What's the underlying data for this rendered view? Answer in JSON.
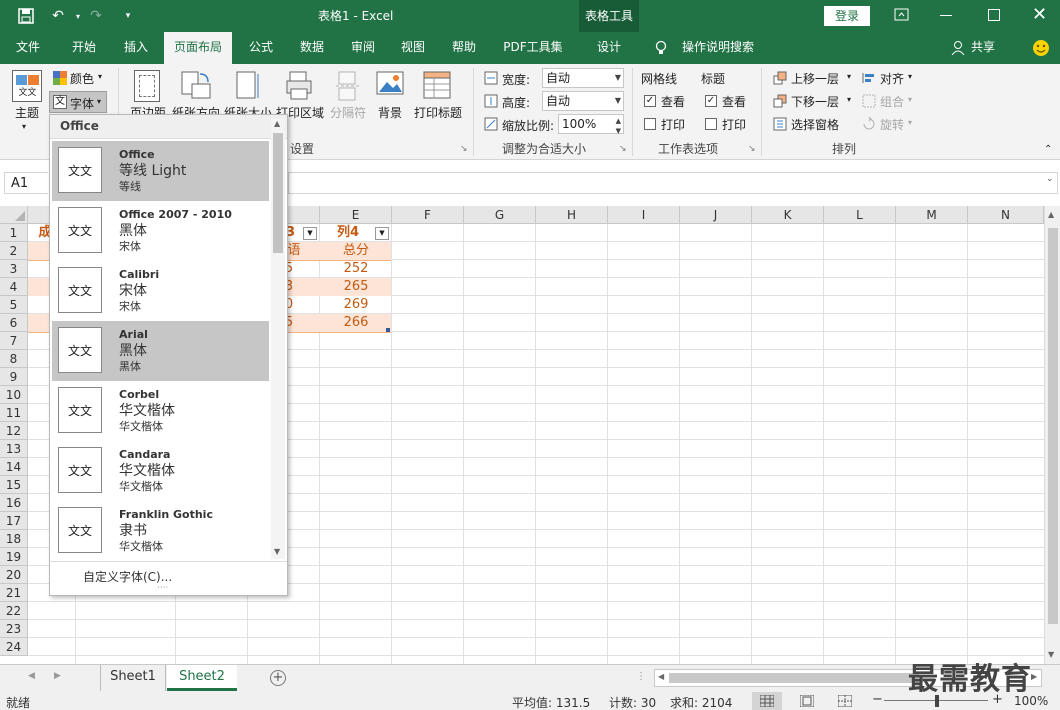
{
  "titlebar": {
    "doc_title": "表格1 - Excel",
    "context_tab_group": "表格工具",
    "login": "登录"
  },
  "tabs": [
    {
      "label": "文件"
    },
    {
      "label": "开始"
    },
    {
      "label": "插入"
    },
    {
      "label": "页面布局"
    },
    {
      "label": "公式"
    },
    {
      "label": "数据"
    },
    {
      "label": "审阅"
    },
    {
      "label": "视图"
    },
    {
      "label": "帮助"
    },
    {
      "label": "PDF工具集"
    },
    {
      "label": "设计"
    }
  ],
  "tell_me": "操作说明搜索",
  "share": "共享",
  "ribbon": {
    "theme": "主题",
    "colors": "颜色",
    "fonts": "字体",
    "margins": "页边距",
    "orientation": "纸张方向",
    "size": "纸张大小",
    "print_area": "打印区域",
    "breaks": "分隔符",
    "background": "背景",
    "print_titles": "打印标题",
    "page_setup_group": "设置",
    "width_label": "宽度:",
    "width_value": "自动",
    "height_label": "高度:",
    "height_value": "自动",
    "scale_label": "缩放比例:",
    "scale_value": "100%",
    "scale_group": "调整为合适大小",
    "gridlines": "网格线",
    "headings": "标题",
    "view": "查看",
    "print": "打印",
    "sheet_options_group": "工作表选项",
    "bring_forward": "上移一层",
    "send_backward": "下移一层",
    "selection_pane": "选择窗格",
    "align": "对齐",
    "group": "组合",
    "rotate": "旋转",
    "arrange_group": "排列"
  },
  "formula_bar": {
    "name_box": "A1"
  },
  "columns": [
    "E",
    "F",
    "G",
    "H",
    "I",
    "J",
    "K",
    "L",
    "M",
    "N"
  ],
  "rows": [
    "1",
    "2",
    "3",
    "4",
    "5",
    "6",
    "7",
    "8",
    "9",
    "10",
    "11",
    "12",
    "13",
    "14",
    "15",
    "16",
    "17",
    "18",
    "19",
    "20",
    "21",
    "22",
    "23",
    "24"
  ],
  "cells": {
    "a1": "成",
    "d1": "3",
    "e1": "列4",
    "d2": "语",
    "e2": "总分",
    "d3": "5",
    "e3": "252",
    "d4": "3",
    "e4": "265",
    "d5": "0",
    "e5": "269",
    "d6": "5",
    "e6": "266"
  },
  "font_dropdown": {
    "header": "Office",
    "items": [
      {
        "name": "Office",
        "heading": "等线 Light",
        "body": "等线",
        "thumb": "文文",
        "selected": true
      },
      {
        "name": "Office 2007 - 2010",
        "heading": "黑体",
        "body": "宋体",
        "thumb": "文文",
        "selected": false
      },
      {
        "name": "Calibri",
        "heading": "宋体",
        "body": "宋体",
        "thumb": "文文",
        "selected": false
      },
      {
        "name": "Arial",
        "heading": "黑体",
        "body": "黑体",
        "thumb": "文文",
        "selected": true
      },
      {
        "name": "Corbel",
        "heading": "华文楷体",
        "body": "华文楷体",
        "thumb": "文文",
        "selected": false
      },
      {
        "name": "Candara",
        "heading": "华文楷体",
        "body": "华文楷体",
        "thumb": "文文",
        "selected": false
      },
      {
        "name": "Franklin Gothic",
        "heading": "隶书",
        "body": "华文楷体",
        "thumb": "文文",
        "selected": false
      }
    ],
    "custom": "自定义字体(C)...",
    "resize_grip": "····"
  },
  "sheets": [
    {
      "label": "Sheet1"
    },
    {
      "label": "Sheet2"
    }
  ],
  "status": {
    "ready": "就绪",
    "average": "平均值: 131.5",
    "count": "计数: 30",
    "sum": "求和: 2104",
    "zoom": "100%"
  },
  "watermark": "最需教育",
  "colors": {
    "excel_green": "#217346",
    "header_orange": "#c55a11",
    "band_fill": "#fce4d6"
  }
}
